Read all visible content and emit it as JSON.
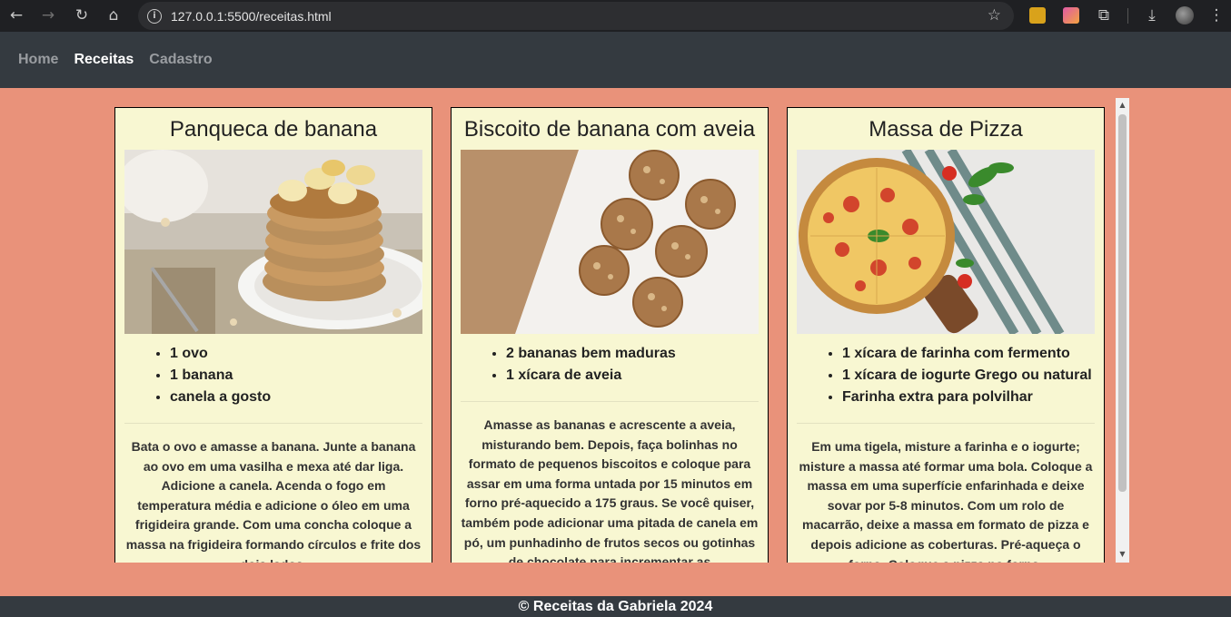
{
  "browser": {
    "url": "127.0.0.1:5500/receitas.html",
    "icons": [
      "back-icon",
      "forward-icon",
      "reload-icon",
      "home-icon",
      "site-info-icon",
      "bookmark-star-icon",
      "extensions-icon",
      "download-icon",
      "profile-avatar",
      "menu-icon"
    ]
  },
  "nav": {
    "items": [
      {
        "label": "Home",
        "active": false
      },
      {
        "label": "Receitas",
        "active": true
      },
      {
        "label": "Cadastro",
        "active": false
      }
    ]
  },
  "recipes": [
    {
      "title": "Panqueca de banana",
      "image": "banana-pancakes-photo",
      "ingredients": [
        "1 ovo",
        "1 banana",
        "canela a gosto"
      ],
      "instructions": "Bata o ovo e amasse a banana. Junte a banana ao ovo em uma vasilha e mexa até dar liga. Adicione a canela. Acenda o fogo em temperatura média e adicione o óleo em uma frigideira grande. Com uma concha coloque a massa na frigideira formando círculos e frite dos dois lados."
    },
    {
      "title": "Biscoito de banana com aveia",
      "image": "oat-banana-cookies-photo",
      "ingredients": [
        "2 bananas bem maduras",
        "1 xícara de aveia"
      ],
      "instructions": "Amasse as bananas e acrescente a aveia, misturando bem. Depois, faça bolinhas no formato de pequenos biscoitos e coloque para assar em uma forma untada por 15 minutos em forno pré-aquecido a 175 graus. Se você quiser, também pode adicionar uma pitada de canela em pó, um punhadinho de frutos secos ou gotinhas de chocolate para incrementar as"
    },
    {
      "title": "Massa de Pizza",
      "image": "pizza-photo",
      "ingredients": [
        "1 xícara de farinha com fermento",
        "1 xícara de iogurte Grego ou natural",
        "Farinha extra para polvilhar"
      ],
      "instructions": "Em uma tigela, misture a farinha e o iogurte; misture a massa até formar uma bola. Coloque a massa em uma superfície enfarinhada e deixe sovar por 5-8 minutos. Com um rolo de macarrão, deixe a massa em formato de pizza e depois adicione as coberturas. Pré-aqueça o forno. Coloque a pizza no forno."
    }
  ],
  "footer": {
    "text": "© Receitas da Gabriela 2024"
  },
  "colors": {
    "page_bg": "#e9927a",
    "card_bg": "#f8f7d2",
    "nav_bg": "#343a40"
  }
}
